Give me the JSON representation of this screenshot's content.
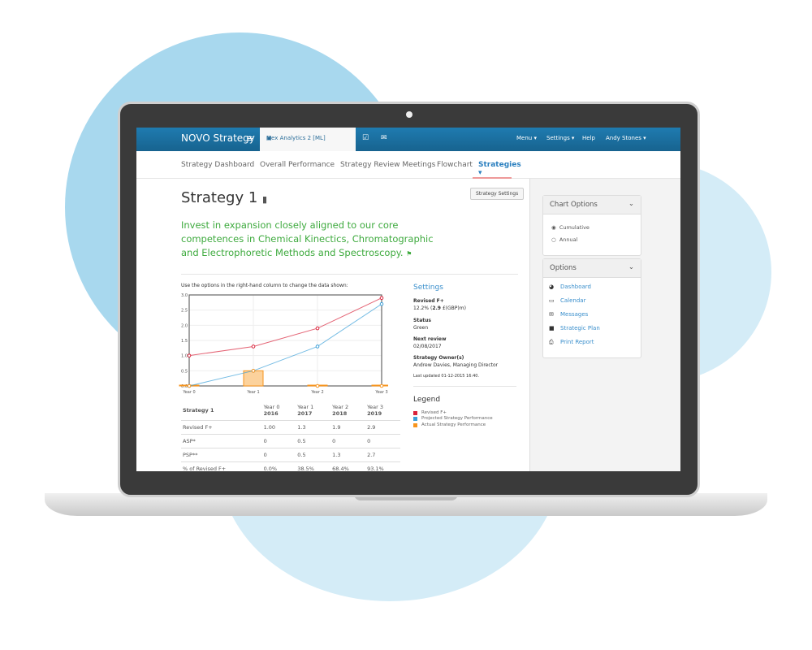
{
  "nav": {
    "brand": "NOVO Strategy",
    "menu_icon": "hamburger-icon",
    "project_tab": "Mex Analytics 2 [ML]",
    "right": [
      "Menu ▾",
      "Settings ▾",
      "Help",
      "Andy Stones ▾"
    ]
  },
  "subnav": [
    "Strategy Dashboard",
    "Overall Performance",
    "Strategy Review Meetings",
    "Flowchart",
    "Strategies ▾"
  ],
  "page": {
    "title": "Strategy 1",
    "settings_button": "Strategy Settings",
    "goal": "Invest in expansion closely aligned to our core competences in Chemical Kinectics, Chromatographic and Electrophoretic Methods and Spectroscopy.",
    "instruction": "Use the options in the right-hand column to change the data shown:"
  },
  "chart_data": {
    "type": "line",
    "categories": [
      "Year 0",
      "Year 1",
      "Year 2",
      "Year 3"
    ],
    "ylim": [
      0,
      3
    ],
    "yticks": [
      "0.0",
      "0.5",
      "1.0",
      "1.5",
      "2.0",
      "2.5",
      "3.0"
    ],
    "grid": true,
    "series": [
      {
        "name": "Revised F+",
        "color": "#d9223a",
        "values": [
          1.0,
          1.3,
          1.9,
          2.9
        ]
      },
      {
        "name": "Projected Strategy Performance",
        "color": "#3a9fd8",
        "values": [
          0,
          0.5,
          1.3,
          2.7
        ]
      },
      {
        "name": "Actual Strategy Performance",
        "color": "#f7941d",
        "type": "bar",
        "values": [
          0,
          0.5,
          0,
          0
        ]
      }
    ]
  },
  "table": {
    "header": [
      "Strategy 1",
      "Year 0",
      "Year 1",
      "Year 2",
      "Year 3"
    ],
    "years": [
      "",
      "2016",
      "2017",
      "2018",
      "2019"
    ],
    "rows": [
      [
        "Revised F+",
        "1.00",
        "1.3",
        "1.9",
        "2.9"
      ],
      [
        "ASP*",
        "0",
        "0.5",
        "0",
        "0"
      ],
      [
        "PSP**",
        "0",
        "0.5",
        "1.3",
        "2.7"
      ],
      [
        "% of Revised F+",
        "0.0%",
        "38.5%",
        "68.4%",
        "93.1%"
      ]
    ]
  },
  "settings": {
    "title": "Settings",
    "revised_label": "Revised F+",
    "revised_value_a": "12.2% (",
    "revised_value_b": "2.9",
    "revised_value_c": " £(GBP)m)",
    "status_label": "Status",
    "status_value": "Green",
    "review_label": "Next review",
    "review_value": "02/08/2017",
    "owner_label": "Strategy Owner(s)",
    "owner_value": "Andrew Davies, Managing Director",
    "updated": "Last updated 01-12-2015 16:40.",
    "legend_title": "Legend"
  },
  "chart_options": {
    "title": "Chart Options",
    "options": [
      "Cumulative",
      "Annual"
    ],
    "selected": "Cumulative"
  },
  "options": {
    "title": "Options",
    "links": [
      {
        "label": "Dashboard",
        "icon": "dashboard-icon"
      },
      {
        "label": "Calendar",
        "icon": "calendar-icon"
      },
      {
        "label": "Messages",
        "icon": "envelope-icon"
      },
      {
        "label": "Strategic Plan",
        "icon": "briefcase-icon"
      },
      {
        "label": "Print Report",
        "icon": "print-icon"
      }
    ]
  }
}
